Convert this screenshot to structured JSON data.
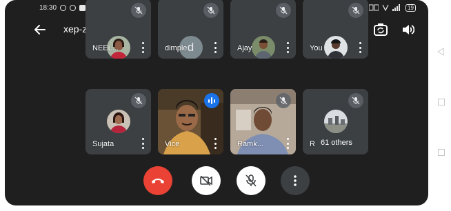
{
  "status_bar": {
    "time": "18:30",
    "battery": "19"
  },
  "header": {
    "meeting_code": "xep-zirn-bov",
    "back_icon": "arrow-back-icon",
    "switch_camera_icon": "switch-camera-icon",
    "speaker_icon": "volume-icon"
  },
  "participants": [
    {
      "name": "NEEL...",
      "muted": true,
      "avatar": "photo"
    },
    {
      "name": "dimple",
      "muted": true,
      "avatar": "letter",
      "initial": "d"
    },
    {
      "name": "Ajay",
      "muted": true,
      "avatar": "photo"
    },
    {
      "name": "You",
      "muted": true,
      "avatar": "photo"
    },
    {
      "name": "Sujata",
      "muted": true,
      "avatar": "photo"
    },
    {
      "name": "Vice",
      "muted": false,
      "speaking": true,
      "avatar": "video"
    },
    {
      "name": "Ramk...",
      "muted": true,
      "avatar": "video"
    },
    {
      "name": "R",
      "muted": true,
      "avatar": "photo"
    }
  ],
  "others": {
    "label": "61 others"
  },
  "controls": {
    "end_call": {
      "icon": "end-call-icon",
      "color": "#ea4335"
    },
    "camera": {
      "icon": "camera-off-icon",
      "state": "off"
    },
    "microphone": {
      "icon": "mic-off-icon",
      "state": "off"
    },
    "more": {
      "icon": "more-vert-icon"
    }
  },
  "colors": {
    "background": "#1f1f1f",
    "tile": "#3c4043",
    "end_call": "#ea4335",
    "speaking": "#1a73e8"
  }
}
